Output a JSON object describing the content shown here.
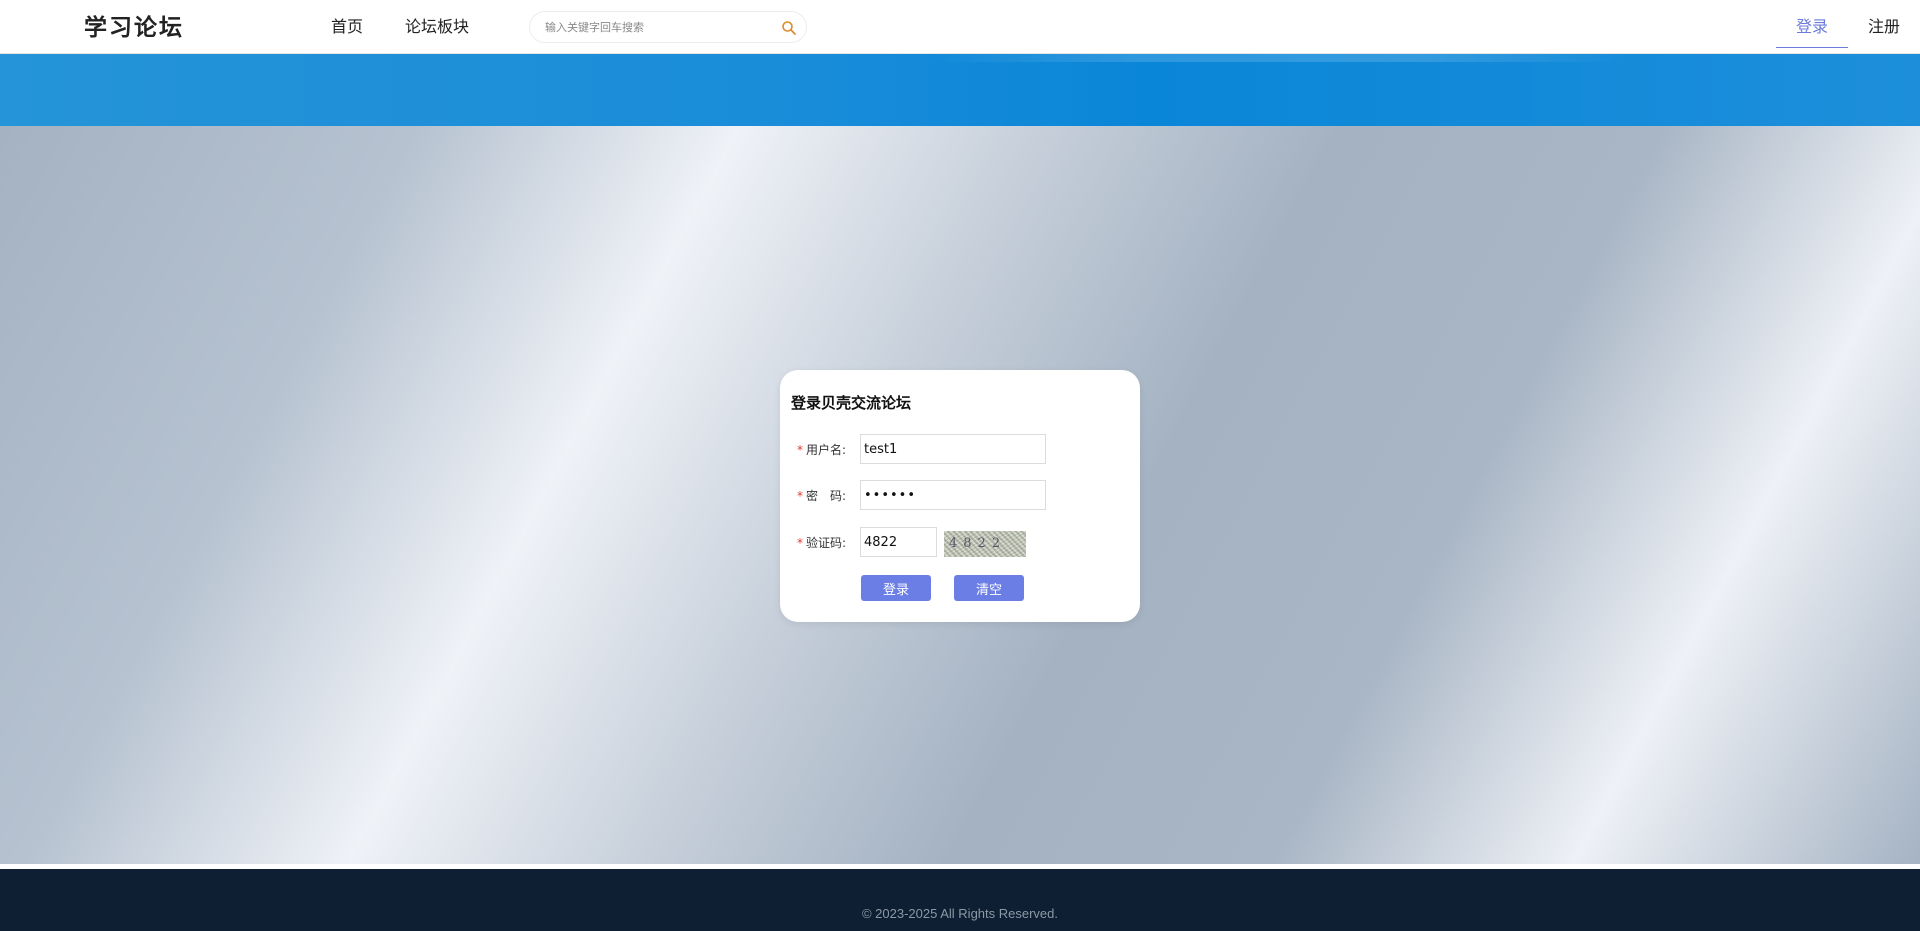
{
  "header": {
    "logo": "学习论坛",
    "nav": {
      "home": "首页",
      "boards": "论坛板块"
    },
    "search": {
      "placeholder": "输入关键字回车搜索",
      "value": ""
    },
    "auth": {
      "login": "登录",
      "register": "注册"
    }
  },
  "login_form": {
    "title": "登录贝壳交流论坛",
    "required_mark": "*",
    "username_label": "用户名:",
    "username_value": "test1",
    "password_label": "密　码:",
    "password_value": "••••••",
    "captcha_label": "验证码:",
    "captcha_value": "4822",
    "captcha_image_text": "4822",
    "login_button": "登录",
    "clear_button": "清空"
  },
  "footer": {
    "copyright": "© 2023-2025 All Rights Reserved."
  },
  "colors": {
    "accent": "#6a7ee6",
    "banner": "#1a8dd9",
    "footer_bg": "#0e1f33",
    "required": "#e5382c"
  },
  "icons": {
    "search": "search-icon"
  }
}
